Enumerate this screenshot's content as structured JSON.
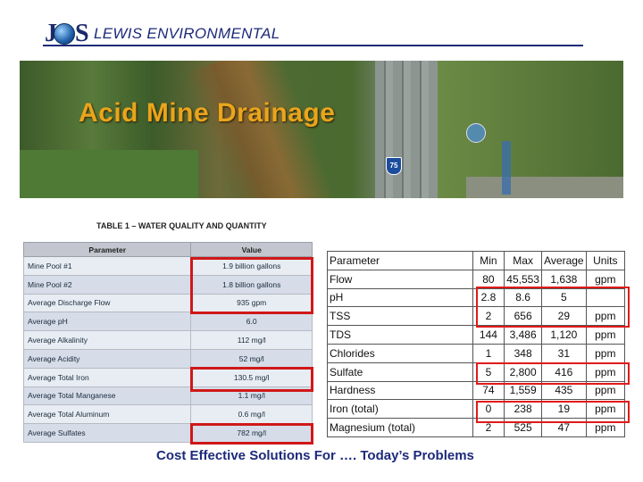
{
  "header": {
    "logo_text": "J S",
    "title": "LEWIS ENVIRONMENTAL"
  },
  "banner": {
    "title": "Acid Mine Drainage",
    "route_shield": "75"
  },
  "table1": {
    "caption": "TABLE 1 – WATER QUALITY AND QUANTITY",
    "headers": [
      "Parameter",
      "Value"
    ],
    "rows": [
      {
        "parameter": "Mine Pool #1",
        "value": "1.9 billion gallons"
      },
      {
        "parameter": "Mine Pool #2",
        "value": "1.8 billion gallons"
      },
      {
        "parameter": "Average Discharge Flow",
        "value": "935 gpm"
      },
      {
        "parameter": "Average pH",
        "value": "6.0"
      },
      {
        "parameter": "Average Alkalinity",
        "value": "112 mg/l"
      },
      {
        "parameter": "Average Acidity",
        "value": "52 mg/l"
      },
      {
        "parameter": "Average Total Iron",
        "value": "130.5 mg/l"
      },
      {
        "parameter": "Average Total Manganese",
        "value": "1.1 mg/l"
      },
      {
        "parameter": "Average Total Aluminum",
        "value": "0.6 mg/l"
      },
      {
        "parameter": "Average Sulfates",
        "value": "782 mg/l"
      }
    ]
  },
  "table2": {
    "headers": [
      "Parameter",
      "Min",
      "Max",
      "Average",
      "Units"
    ],
    "rows": [
      [
        "Flow",
        "80",
        "45,553",
        "1,638",
        "gpm"
      ],
      [
        "pH",
        "2.8",
        "8.6",
        "5",
        ""
      ],
      [
        "TSS",
        "2",
        "656",
        "29",
        "ppm"
      ],
      [
        "TDS",
        "144",
        "3,486",
        "1,120",
        "ppm"
      ],
      [
        "Chlorides",
        "1",
        "348",
        "31",
        "ppm"
      ],
      [
        "Sulfate",
        "5",
        "2,800",
        "416",
        "ppm"
      ],
      [
        "Hardness",
        "74",
        "1,559",
        "435",
        "ppm"
      ],
      [
        "Iron (total)",
        "0",
        "238",
        "19",
        "ppm"
      ],
      [
        "Magnesium (total)",
        "2",
        "525",
        "47",
        "ppm"
      ]
    ]
  },
  "footer": {
    "tagline": "Cost Effective Solutions For …. Today’s Problems"
  },
  "colors": {
    "brand_blue": "#1d2a7a",
    "highlight_red": "#d01818",
    "banner_title": "#e9a51c"
  }
}
